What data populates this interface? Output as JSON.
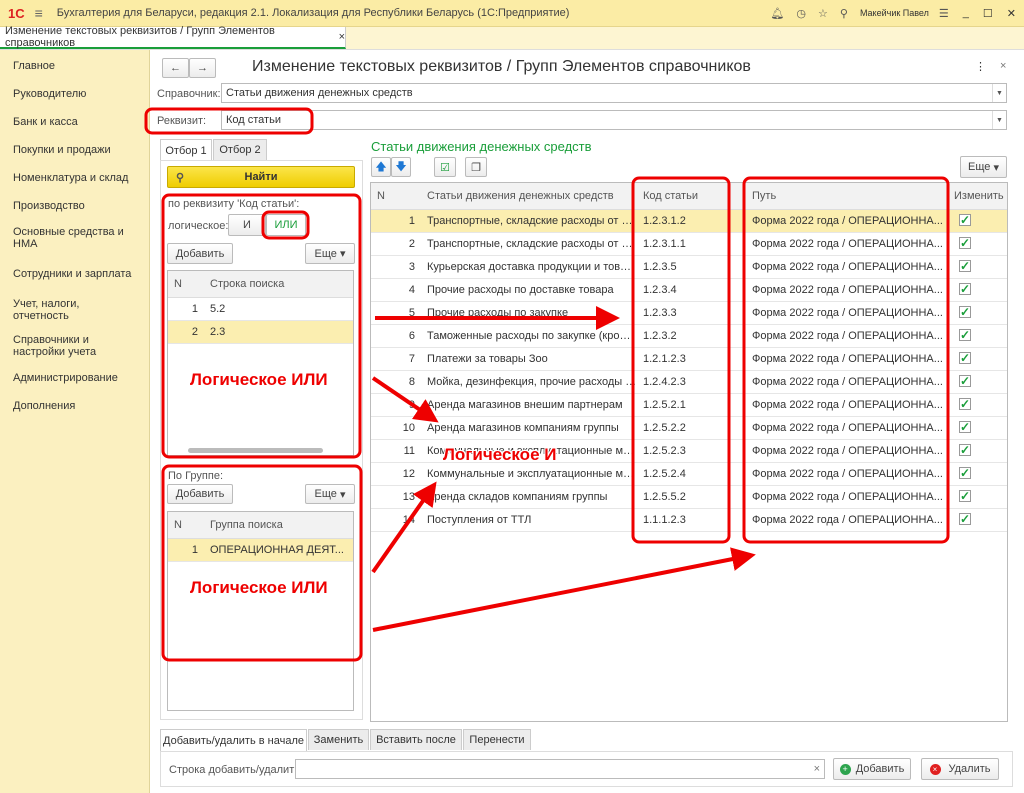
{
  "app": {
    "title": "Бухгалтерия для Беларуси, редакция 2.1. Локализация для Республики Беларусь  (1С:Предприятие)",
    "user": "Макейчик Павел",
    "logo": "1С"
  },
  "open_tab": "Изменение текстовых реквизитов / Групп Элементов справочников",
  "sidebar": {
    "items": [
      {
        "label": "Главное"
      },
      {
        "label": "Руководителю"
      },
      {
        "label": "Банк и касса"
      },
      {
        "label": "Покупки и продажи"
      },
      {
        "label": "Номенклатура и склад"
      },
      {
        "label": "Производство"
      },
      {
        "label": "Основные средства и НМА"
      },
      {
        "label": "Сотрудники и зарплата"
      },
      {
        "label": "Учет, налоги, отчетность"
      },
      {
        "label": "Справочники и настройки учета"
      },
      {
        "label": "Администрирование"
      },
      {
        "label": "Дополнения"
      }
    ]
  },
  "form": {
    "title": "Изменение текстовых реквизитов / Групп Элементов справочников",
    "catalog_label": "Справочник:",
    "catalog_value": "Статьи движения денежных средств",
    "attr_label": "Реквизит:",
    "attr_value": "Код статьи"
  },
  "left": {
    "tabs": [
      "Отбор 1",
      "Отбор 2"
    ],
    "find": "Найти",
    "by_attr": "по реквизиту 'Код статьи':",
    "logical": "логическое:",
    "and": "И",
    "or": "ИЛИ",
    "add": "Добавить",
    "more": "Еще",
    "search_table": {
      "headers": [
        "N",
        "Строка поиска"
      ],
      "rows": [
        [
          "1",
          "5.2"
        ],
        [
          "2",
          "2.3"
        ]
      ]
    },
    "by_group": "По Группе:",
    "group_table": {
      "headers": [
        "N",
        "Группа поиска"
      ],
      "rows": [
        [
          "1",
          "ОПЕРАЦИОННАЯ ДЕЯТ..."
        ]
      ]
    }
  },
  "right": {
    "title": "Статьи движения денежных средств",
    "more": "Еще",
    "headers": [
      "N",
      "Статьи движения денежных средств",
      "Код статьи",
      "Путь",
      "Изменить"
    ],
    "rows": [
      [
        "1",
        "Транспортные, складские расходы от ко...",
        "1.2.3.1.2",
        "Форма 2022 года / ОПЕРАЦИОННА..."
      ],
      [
        "2",
        "Транспортные, складские расходы от ст...",
        "1.2.3.1.1",
        "Форма 2022 года / ОПЕРАЦИОННА..."
      ],
      [
        "3",
        "Курьерская доставка продукции и товар...",
        "1.2.3.5",
        "Форма 2022 года / ОПЕРАЦИОННА..."
      ],
      [
        "4",
        "Прочие расходы по доставке товара",
        "1.2.3.4",
        "Форма 2022 года / ОПЕРАЦИОННА..."
      ],
      [
        "5",
        "Прочие расходы по закупке",
        "1.2.3.3",
        "Форма 2022 года / ОПЕРАЦИОННА..."
      ],
      [
        "6",
        "Таможенные расходы по закупке (кроме...",
        "1.2.3.2",
        "Форма 2022 года / ОПЕРАЦИОННА..."
      ],
      [
        "7",
        "Платежи за товары Зоо",
        "1.2.1.2.3",
        "Форма 2022 года / ОПЕРАЦИОННА..."
      ],
      [
        "8",
        "Мойка, дезинфекция, прочие расходы н...",
        "1.2.4.2.3",
        "Форма 2022 года / ОПЕРАЦИОННА..."
      ],
      [
        "9",
        "Аренда магазинов внешим партнерам",
        "1.2.5.2.1",
        "Форма 2022 года / ОПЕРАЦИОННА..."
      ],
      [
        "10",
        "Аренда магазинов компаниям группы",
        "1.2.5.2.2",
        "Форма 2022 года / ОПЕРАЦИОННА..."
      ],
      [
        "11",
        "Коммунальные и эксплуатационные маг...",
        "1.2.5.2.3",
        "Форма 2022 года / ОПЕРАЦИОННА..."
      ],
      [
        "12",
        "Коммунальные и эксплуатационные маг...",
        "1.2.5.2.4",
        "Форма 2022 года / ОПЕРАЦИОННА..."
      ],
      [
        "13",
        "Аренда складов компаниям группы",
        "1.2.5.5.2",
        "Форма 2022 года / ОПЕРАЦИОННА..."
      ],
      [
        "14",
        "Поступления от ТТЛ",
        "1.1.1.2.3",
        "Форма 2022 года / ОПЕРАЦИОННА..."
      ]
    ]
  },
  "bottom": {
    "tabs": [
      "Добавить/удалить в начале",
      "Заменить",
      "Вставить после",
      "Перенести"
    ],
    "label": "Строка добавить/удалить:",
    "value": "",
    "add": "Добавить",
    "delete": "Удалить"
  },
  "annotations": {
    "or1": "Логическое ИЛИ",
    "and": "Логическое И",
    "or2": "Логическое ИЛИ"
  },
  "colors": {
    "annotation": "#e00000",
    "accent_green": "#1a9e3a",
    "highlight": "#fbeeb0",
    "button_yellow": "#f5d800"
  }
}
